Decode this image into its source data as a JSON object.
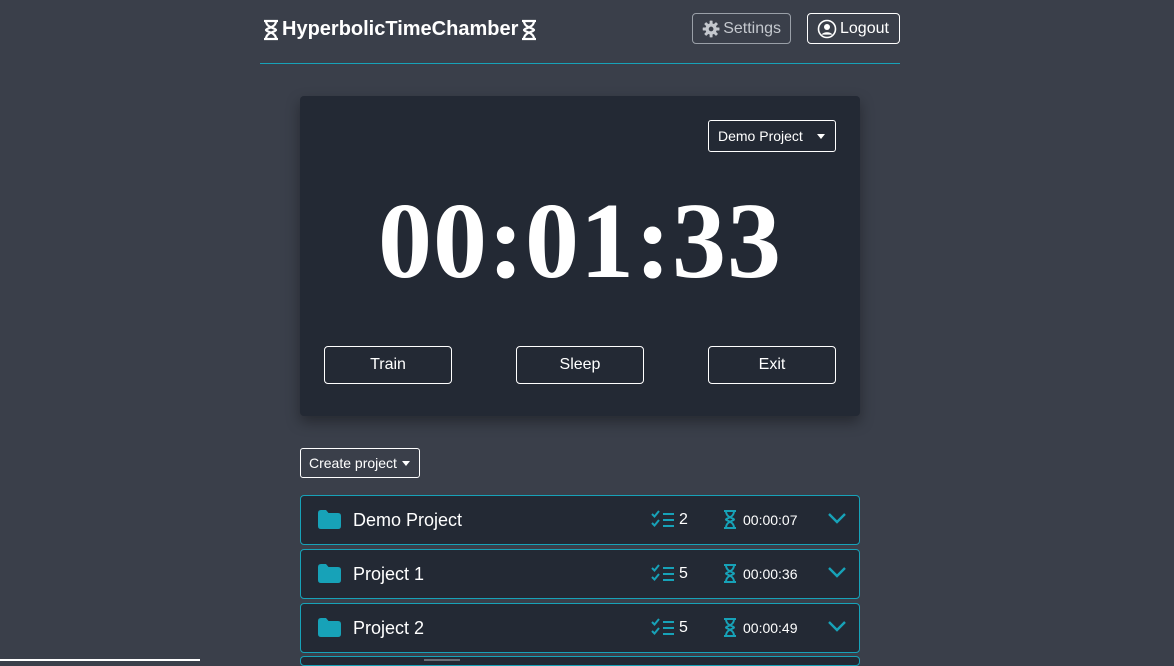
{
  "header": {
    "brand": "HyperbolicTimeChamber",
    "settings_label": "Settings",
    "logout_label": "Logout"
  },
  "timer": {
    "selected_project": "Demo Project",
    "display": "00:01:33",
    "buttons": [
      "Train",
      "Sleep",
      "Exit"
    ]
  },
  "create_project_label": "Create project",
  "projects": [
    {
      "name": "Demo Project",
      "tasks": "2",
      "time": "00:00:07"
    },
    {
      "name": "Project 1",
      "tasks": "5",
      "time": "00:00:36"
    },
    {
      "name": "Project 2",
      "tasks": "5",
      "time": "00:00:49"
    }
  ],
  "colors": {
    "background": "#3a3f4a",
    "card": "#232934",
    "accent": "#17a2b8",
    "text": "#ffffff"
  }
}
